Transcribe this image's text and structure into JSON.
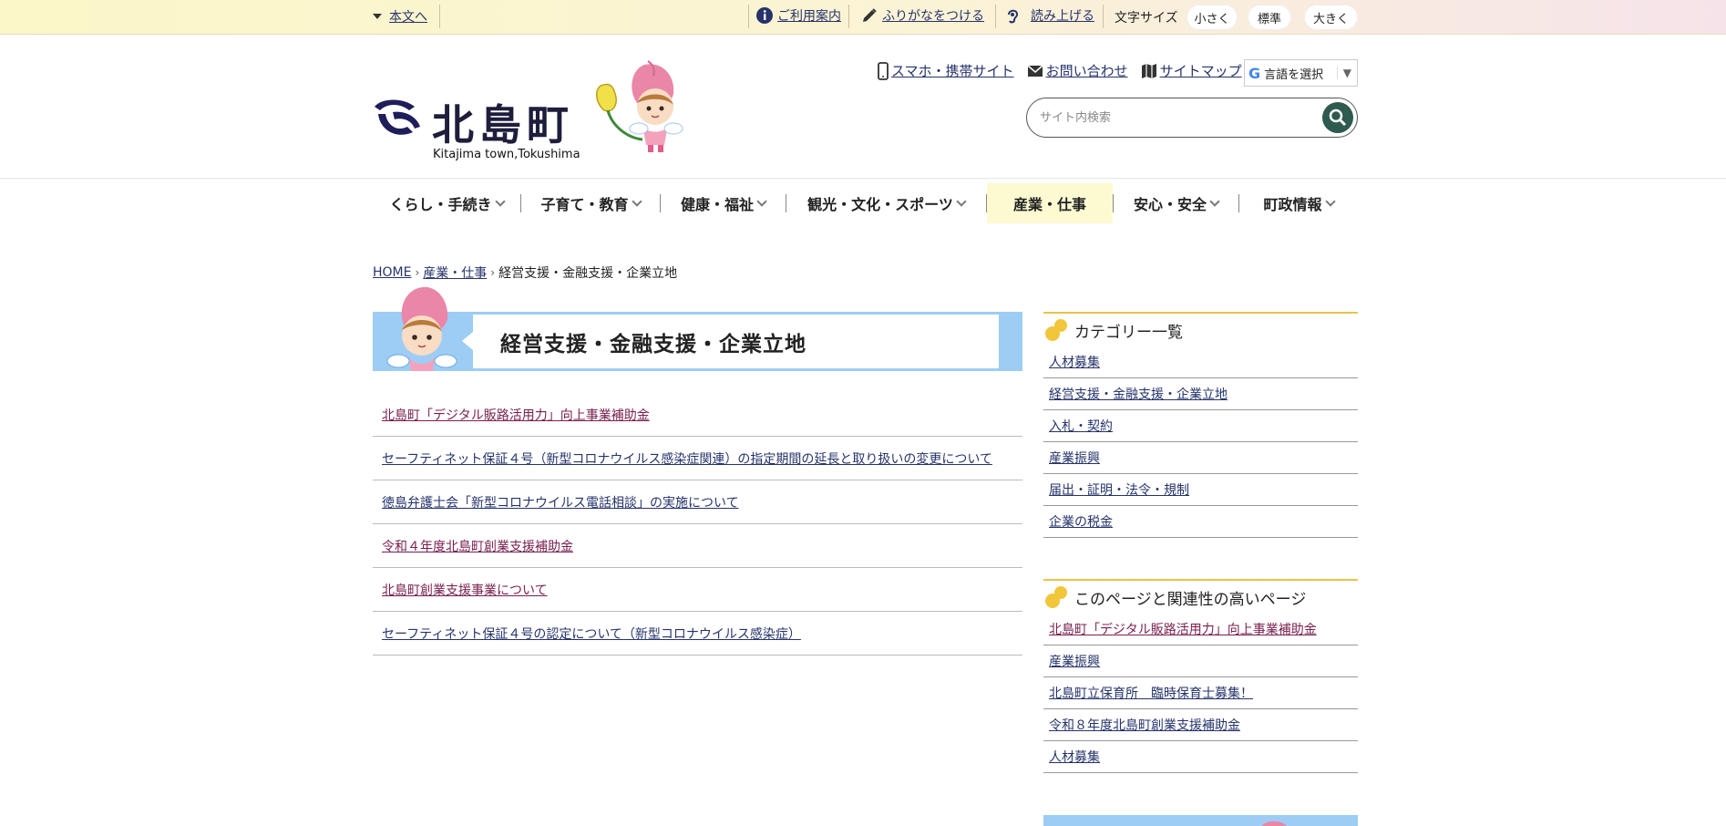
{
  "topbar": {
    "skip_label": "本文へ",
    "guide_label": "ご利用案内",
    "furigana_label": "ふりがなをつける",
    "readaloud_label": "読み上げる",
    "fontsize_label": "文字サイズ",
    "fontsize_small": "小さく",
    "fontsize_normal": "標準",
    "fontsize_large": "大きく"
  },
  "header": {
    "logo_text": "北島町",
    "logo_sub": "Kitajima town,Tokushima",
    "links": {
      "mobile": "スマホ・携帯サイト",
      "contact": "お問い合わせ",
      "sitemap": "サイトマップ"
    },
    "language_label": "言語を選択",
    "search_placeholder": "サイト内検索"
  },
  "gnav": {
    "items": [
      {
        "label": "くらし・手続き"
      },
      {
        "label": "子育て・教育"
      },
      {
        "label": "健康・福祉"
      },
      {
        "label": "観光・文化・スポーツ"
      },
      {
        "label": "産業・仕事"
      },
      {
        "label": "安心・安全"
      },
      {
        "label": "町政情報"
      }
    ]
  },
  "breadcrumb": {
    "home": "HOME",
    "parent": "産業・仕事",
    "current": "経営支援・金融支援・企業立地"
  },
  "page_title": "経営支援・金融支援・企業立地",
  "articles": [
    {
      "title": "北島町「デジタル販路活用力」向上事業補助金"
    },
    {
      "title": "セーフティネット保証４号（新型コロナウイルス感染症関連）の指定期間の延長と取り扱いの変更について"
    },
    {
      "title": "徳島弁護士会「新型コロナウイルス電話相談」の実施について"
    },
    {
      "title": "令和４年度北島町創業支援補助金"
    },
    {
      "title": "北島町創業支援事業について"
    },
    {
      "title": "セーフティネット保証４号の認定について（新型コロナウイルス感染症）"
    }
  ],
  "sidebar": {
    "category_heading": "カテゴリー一覧",
    "categories": [
      {
        "label": "人材募集"
      },
      {
        "label": "経営支援・金融支援・企業立地"
      },
      {
        "label": "入札・契約"
      },
      {
        "label": "産業振興"
      },
      {
        "label": "届出・証明・法令・規制"
      },
      {
        "label": "企業の税金"
      }
    ],
    "related_heading": "このページと関連性の高いページ",
    "related": [
      {
        "label": "北島町「デジタル販路活用力」向上事業補助金"
      },
      {
        "label": "産業振興"
      },
      {
        "label": "北島町立保育所　臨時保育士募集！"
      },
      {
        "label": "令和８年度北島町創業支援補助金"
      },
      {
        "label": "人材募集"
      }
    ]
  },
  "colors": {
    "link": "#26336b",
    "visited_link": "#7a2050",
    "title_band": "#9dcdf4",
    "nav_active_bg": "#fdfad2",
    "sidebar_accent": "#e8c447",
    "search_button": "#2e5a4f"
  }
}
